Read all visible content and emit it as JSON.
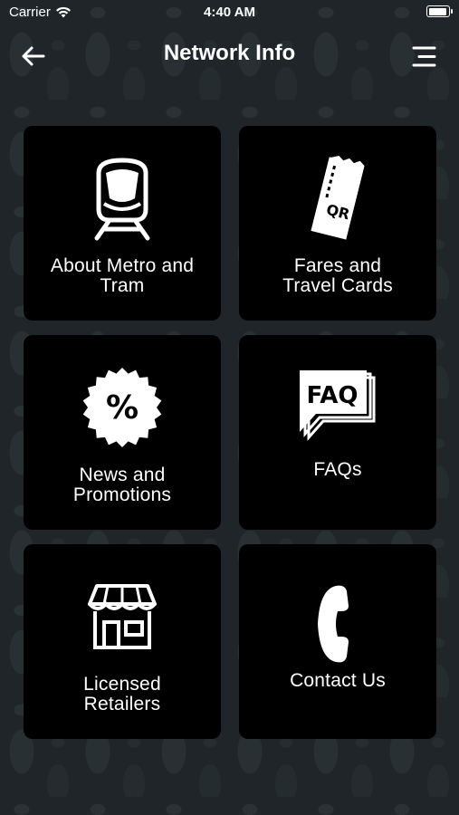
{
  "status_bar": {
    "carrier": "Carrier",
    "time": "4:40 AM",
    "battery_level": 0.92
  },
  "nav": {
    "title": "Network Info",
    "back_icon": "arrow-left-icon",
    "menu_icon": "menu-icon"
  },
  "tiles": [
    {
      "label_line1": "About Metro and",
      "label_line2": "Tram",
      "icon": "tram-icon"
    },
    {
      "label_line1": "Fares and",
      "label_line2": "Travel Cards",
      "icon": "ticket-qr-icon",
      "icon_text": "QR"
    },
    {
      "label_line1": "News and",
      "label_line2": "Promotions",
      "icon": "percent-badge-icon",
      "icon_text": "%"
    },
    {
      "label_line1": "FAQs",
      "icon": "faq-bubble-icon",
      "icon_text": "FAQ"
    },
    {
      "label_line1": "Licensed",
      "label_line2": "Retailers",
      "icon": "store-icon"
    },
    {
      "label_line1": "Contact Us",
      "icon": "phone-icon"
    }
  ],
  "colors": {
    "tile_background": "#000000",
    "text": "#ffffff",
    "page_background": "#1f2528"
  }
}
